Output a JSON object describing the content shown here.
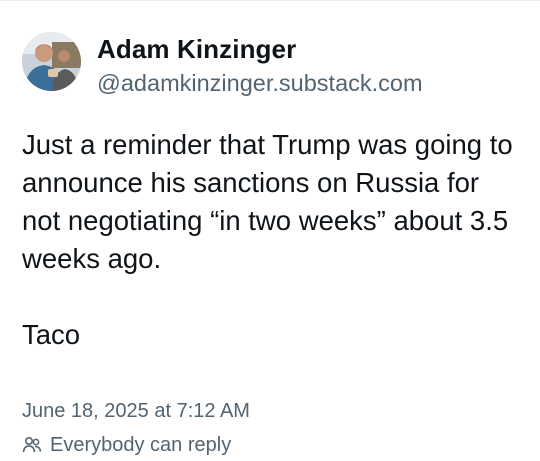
{
  "post": {
    "author": {
      "display_name": "Adam Kinzinger",
      "handle": "@adamkinzinger.substack.com",
      "avatar_icon": "profile-photo"
    },
    "paragraphs": [
      "Just a reminder that Trump was going to announce his sanctions on Russia for not negotiating “in two weeks” about 3.5 weeks ago.",
      "Taco"
    ],
    "timestamp": "June 18, 2025 at 7:12 AM",
    "reply_setting": {
      "label": "Everybody can reply",
      "icon": "people-icon"
    }
  },
  "colors": {
    "text_primary": "#0f1419",
    "text_secondary": "#536471",
    "background": "#ffffff"
  }
}
